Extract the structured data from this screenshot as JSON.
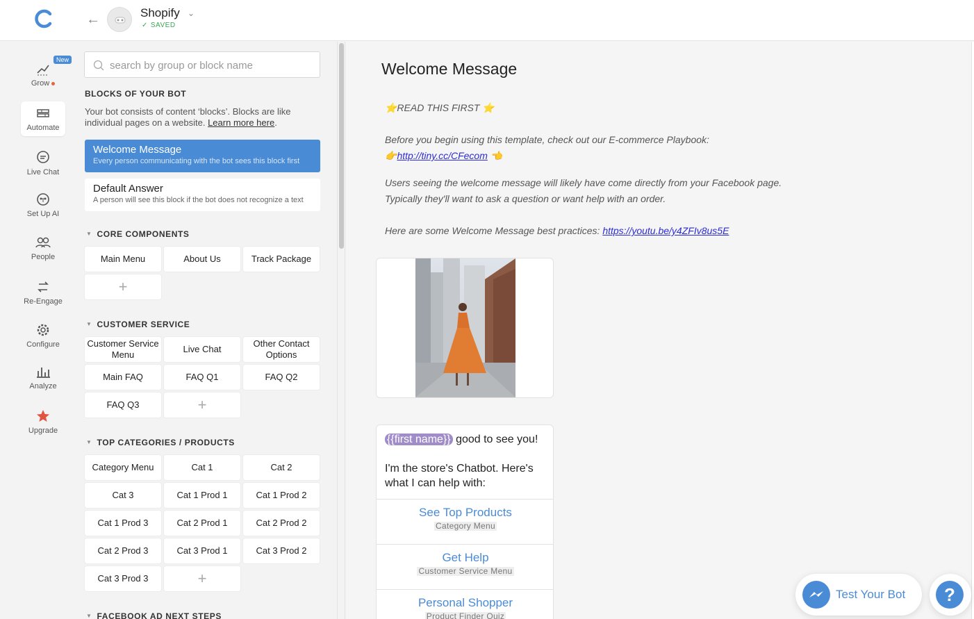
{
  "header": {
    "bot_name": "Shopify",
    "status": "SAVED"
  },
  "nav": {
    "new_badge": "New",
    "items": [
      {
        "label": "Grow"
      },
      {
        "label": "Automate"
      },
      {
        "label": "Live Chat"
      },
      {
        "label": "Set Up AI"
      },
      {
        "label": "People"
      },
      {
        "label": "Re-Engage"
      },
      {
        "label": "Configure"
      },
      {
        "label": "Analyze"
      },
      {
        "label": "Upgrade"
      }
    ]
  },
  "search": {
    "placeholder": "search by group or block name"
  },
  "blocks": {
    "title": "BLOCKS OF YOUR BOT",
    "description": "Your bot consists of content ‘blocks’. Blocks are like individual pages on a website.",
    "learn_more": "Learn more here",
    "welcome": {
      "title": "Welcome Message",
      "desc": "Every person communicating with the bot sees this block first"
    },
    "default": {
      "title": "Default Answer",
      "desc": "A person will see this block if the bot does not recognize a text"
    }
  },
  "groups": [
    {
      "title": "CORE COMPONENTS",
      "blocks": [
        "Main Menu",
        "About Us",
        "Track Package"
      ]
    },
    {
      "title": "CUSTOMER SERVICE",
      "blocks": [
        "Customer Service Menu",
        "Live Chat",
        "Other Contact Options",
        "Main FAQ",
        "FAQ Q1",
        "FAQ Q2",
        "FAQ Q3"
      ]
    },
    {
      "title": "TOP CATEGORIES / PRODUCTS",
      "blocks": [
        "Category Menu",
        "Cat 1",
        "Cat 2",
        "Cat 3",
        "Cat 1 Prod 1",
        "Cat 1 Prod 2",
        "Cat 1 Prod 3",
        "Cat 2 Prod 1",
        "Cat 2 Prod 2",
        "Cat 2 Prod 3",
        "Cat 3 Prod 1",
        "Cat 3 Prod 2",
        "Cat 3 Prod 3"
      ]
    },
    {
      "title": "FACEBOOK AD NEXT STEPS",
      "blocks": []
    }
  ],
  "add_symbol": "+",
  "editor": {
    "title": "Welcome Message",
    "note": {
      "line1": "⭐READ THIS FIRST ⭐",
      "line2": "Before you begin using this template, check out our E-commerce Playbook:",
      "line3_prefix": "👉",
      "line3_link": "http://tiny.cc/CFecom",
      "line3_suffix": " 👈",
      "line4": "Users seeing the welcome message will likely have come directly from your Facebook page.",
      "line5": "Typically they'll want to ask a question or want help with an order.",
      "line6_text": "Here are some Welcome Message best practices: ",
      "line6_link": "https://youtu.be/y4ZFIv8us5E"
    },
    "text_card": {
      "first_name_tag": "{{first name}}",
      "greeting": " good to see you!",
      "body": "I'm the store's Chatbot.  Here's what I can help with:",
      "buttons": [
        {
          "title": "See Top Products",
          "target": "Category Menu"
        },
        {
          "title": "Get Help",
          "target": "Customer Service Menu"
        },
        {
          "title": "Personal Shopper",
          "target": "Product Finder Quiz"
        }
      ]
    }
  },
  "widgets": {
    "test_bot": "Test Your Bot",
    "help": "?"
  },
  "colors": {
    "accent": "#4a8bd6",
    "saved": "#3aa657",
    "first_name_tag": "#a08cc8",
    "upgrade_star": "#e0553f"
  }
}
